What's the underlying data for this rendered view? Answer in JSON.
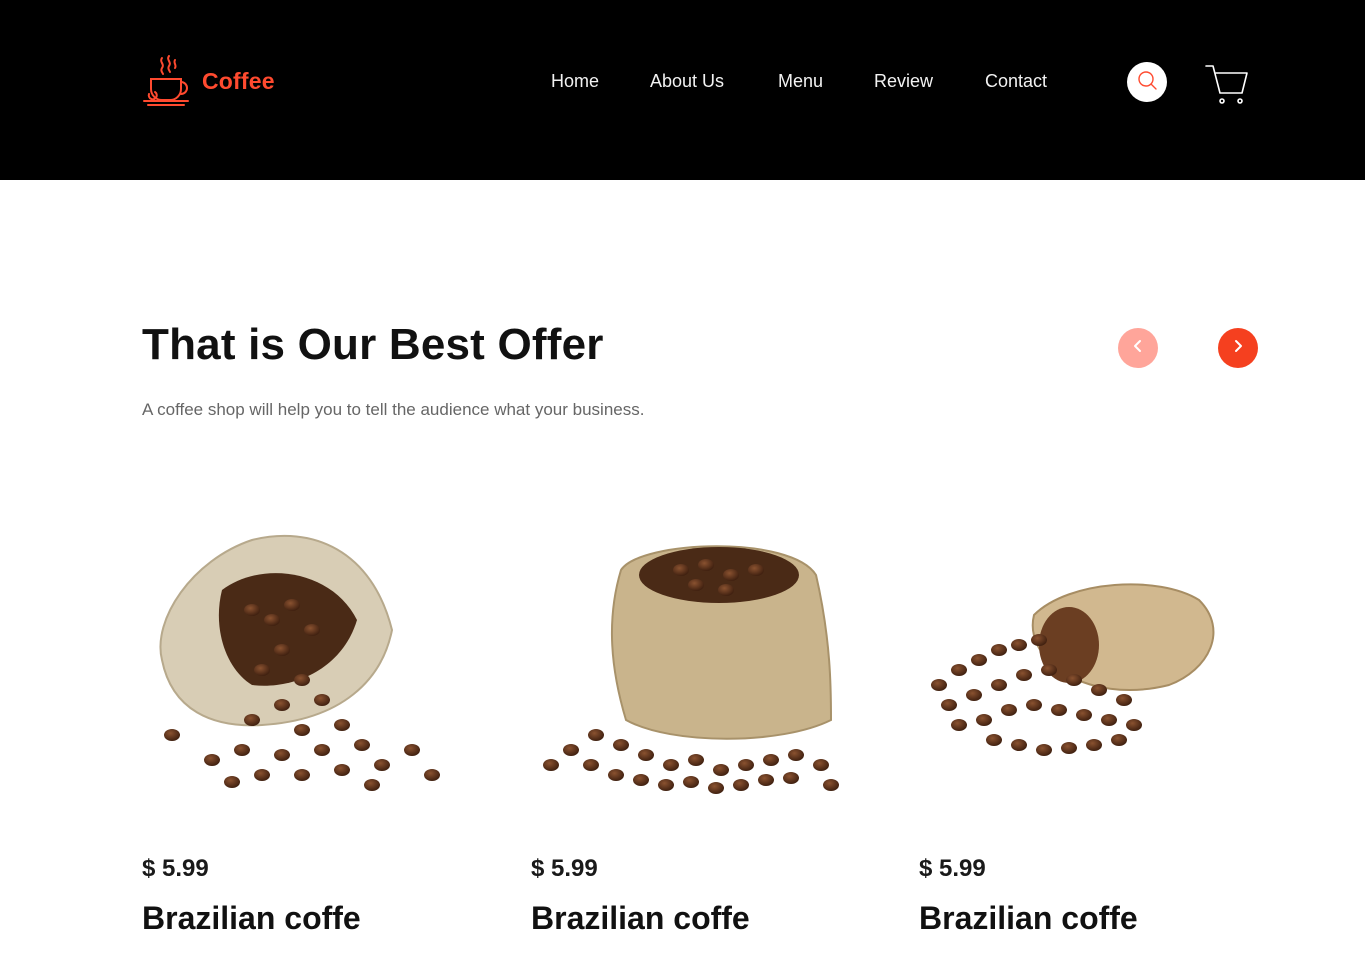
{
  "brand": {
    "name": "Coffee",
    "icon": "coffee-cup-icon",
    "color": "#ff4a2f"
  },
  "nav": {
    "items": [
      {
        "label": "Home"
      },
      {
        "label": "About Us"
      },
      {
        "label": "Menu"
      },
      {
        "label": "Review"
      },
      {
        "label": "Contact"
      }
    ]
  },
  "header_actions": {
    "search_icon": "search-icon",
    "cart_icon": "cart-icon"
  },
  "offer": {
    "title": "That is Our Best Offer",
    "subtitle": "A coffee shop will help you to tell the audience what your business.",
    "prev_icon": "chevron-left-icon",
    "next_icon": "chevron-right-icon",
    "accent": "#f5401f",
    "accent_light": "#ffa59a"
  },
  "products": [
    {
      "price": "$ 5.99",
      "name": "Brazilian coffe",
      "image": "coffee-sack-tipped-image"
    },
    {
      "price": "$ 5.99",
      "name": "Brazilian coffe",
      "image": "coffee-sack-upright-image"
    },
    {
      "price": "$ 5.99",
      "name": "Brazilian coffe",
      "image": "coffee-sack-spilled-image"
    }
  ]
}
